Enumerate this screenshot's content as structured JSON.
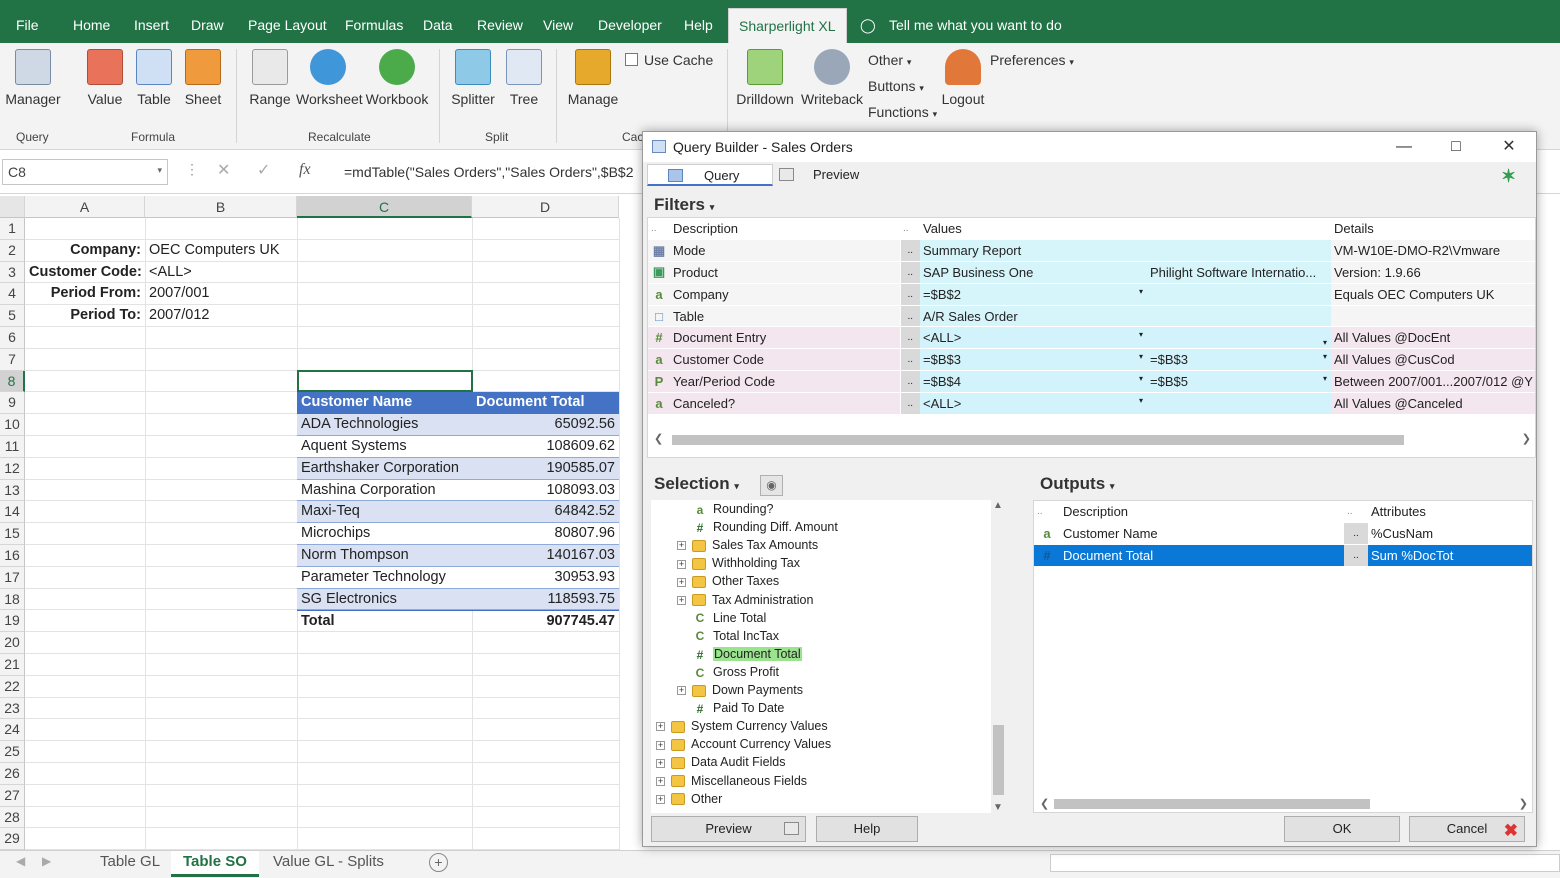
{
  "ribbon": {
    "tabs": [
      "File",
      "Home",
      "Insert",
      "Draw",
      "Page Layout",
      "Formulas",
      "Data",
      "Review",
      "View",
      "Developer",
      "Help",
      "Sharperlight XL"
    ],
    "tell_me": "Tell me what you want to do",
    "buttons": {
      "manager": "Manager",
      "value": "Value",
      "table": "Table",
      "sheet": "Sheet",
      "range": "Range",
      "worksheet": "Worksheet",
      "workbook": "Workbook",
      "splitter": "Splitter",
      "tree": "Tree",
      "manage": "Manage",
      "use_cache": "Use Cache",
      "drilldown": "Drilldown",
      "writeback": "Writeback",
      "other": "Other",
      "buttons": "Buttons",
      "functions": "Functions",
      "logout": "Logout",
      "preferences": "Preferences"
    },
    "groups": {
      "query": "Query",
      "formula": "Formula",
      "recalculate": "Recalculate",
      "split": "Split",
      "cache": "Cac"
    }
  },
  "formula_bar": {
    "name_box": "C8",
    "fx": "fx",
    "formula": "=mdTable(\"Sales Orders\",\"Sales Orders\",$B$2"
  },
  "sheet": {
    "columns": [
      "A",
      "B",
      "C",
      "D"
    ],
    "rows": [
      "1",
      "2",
      "3",
      "4",
      "5",
      "6",
      "7",
      "8",
      "9",
      "10",
      "11",
      "12",
      "13",
      "14",
      "15",
      "16",
      "17",
      "18",
      "19",
      "20",
      "21",
      "22",
      "23",
      "24",
      "25",
      "26",
      "27",
      "28",
      "29"
    ],
    "params": [
      {
        "label": "Company:",
        "value": "OEC Computers UK"
      },
      {
        "label": "Customer Code:",
        "value": "<ALL>"
      },
      {
        "label": "Period From:",
        "value": "2007/001"
      },
      {
        "label": "Period To:",
        "value": "2007/012"
      }
    ],
    "table_header": [
      "Customer Name",
      "Document Total"
    ],
    "table_rows": [
      [
        "ADA Technologies",
        "65092.56"
      ],
      [
        "Aquent Systems",
        "108609.62"
      ],
      [
        "Earthshaker Corporation",
        "190585.07"
      ],
      [
        "Mashina Corporation",
        "108093.03"
      ],
      [
        "Maxi-Teq",
        "64842.52"
      ],
      [
        "Microchips",
        "80807.96"
      ],
      [
        "Norm Thompson",
        "140167.03"
      ],
      [
        "Parameter Technology",
        "30953.93"
      ],
      [
        "SG Electronics",
        "118593.75"
      ]
    ],
    "total": [
      "Total",
      "907745.47"
    ],
    "tabs": [
      "Table GL",
      "Table SO",
      "Value GL - Splits"
    ]
  },
  "dialog": {
    "title": "Query Builder - Sales Orders",
    "tabs": [
      "Query",
      "Preview"
    ],
    "filters_label": "Filters",
    "filter_cols": [
      "Description",
      "Values",
      "Details"
    ],
    "filters": [
      {
        "desc": "Mode",
        "v1": "Summary Report",
        "v2": "",
        "details": "VM-W10E-DMO-R2\\Vmware"
      },
      {
        "desc": "Product",
        "v1": "SAP Business One",
        "v2": "Philight Software Internatio...",
        "details": "Version: 1.9.66"
      },
      {
        "desc": "Company",
        "v1": "=$B$2",
        "v2": "",
        "details": "Equals OEC Computers UK"
      },
      {
        "desc": "Table",
        "v1": "A/R Sales Order",
        "v2": "",
        "details": ""
      },
      {
        "desc": "Document Entry",
        "v1": "<ALL>",
        "v2": "",
        "details": "All Values @DocEnt"
      },
      {
        "desc": "Customer Code",
        "v1": "=$B$3",
        "v2": "=$B$3",
        "details": "All Values @CusCod"
      },
      {
        "desc": "Year/Period Code",
        "v1": "=$B$4",
        "v2": "=$B$5",
        "details": "Between 2007/001...2007/012 @Y"
      },
      {
        "desc": "Canceled?",
        "v1": "<ALL>",
        "v2": "",
        "details": "All Values @Canceled"
      }
    ],
    "selection_label": "Selection",
    "tree": [
      {
        "label": "Rounding?",
        "type": "a",
        "level": 2
      },
      {
        "label": "Rounding Diff. Amount",
        "type": "#",
        "level": 2
      },
      {
        "label": "Sales Tax Amounts",
        "type": "folder",
        "level": 1
      },
      {
        "label": "Withholding Tax",
        "type": "folder",
        "level": 1
      },
      {
        "label": "Other Taxes",
        "type": "folder",
        "level": 1
      },
      {
        "label": "Tax Administration",
        "type": "folder",
        "level": 1
      },
      {
        "label": "Line Total",
        "type": "C",
        "level": 2
      },
      {
        "label": "Total IncTax",
        "type": "C",
        "level": 2
      },
      {
        "label": "Document Total",
        "type": "#",
        "level": 2
      },
      {
        "label": "Gross Profit",
        "type": "C",
        "level": 2
      },
      {
        "label": "Down Payments",
        "type": "folder",
        "level": 1
      },
      {
        "label": "Paid To Date",
        "type": "#",
        "level": 2
      },
      {
        "label": "System Currency Values",
        "type": "folder",
        "level": 0
      },
      {
        "label": "Account Currency Values",
        "type": "folder",
        "level": 0
      },
      {
        "label": "Data Audit Fields",
        "type": "folder",
        "level": 0
      },
      {
        "label": "Miscellaneous Fields",
        "type": "folder",
        "level": 0
      },
      {
        "label": "Other",
        "type": "folder",
        "level": 0
      }
    ],
    "outputs_label": "Outputs",
    "output_cols": [
      "Description",
      "Attributes"
    ],
    "outputs": [
      {
        "desc": "Customer Name",
        "attr": "%CusNam"
      },
      {
        "desc": "Document Total",
        "attr": "Sum %DocTot"
      }
    ],
    "buttons": {
      "preview": "Preview",
      "help": "Help",
      "ok": "OK",
      "cancel": "Cancel"
    }
  }
}
